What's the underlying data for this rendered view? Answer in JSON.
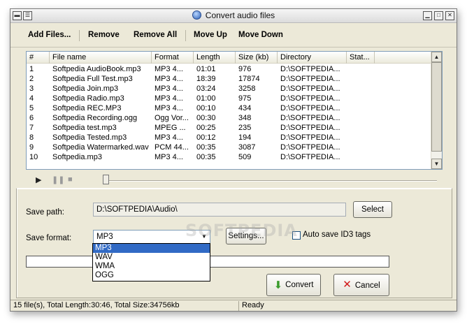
{
  "window": {
    "title": "Convert audio files"
  },
  "toolbar": {
    "add_files": "Add Files...",
    "remove": "Remove",
    "remove_all": "Remove All",
    "move_up": "Move Up",
    "move_down": "Move Down"
  },
  "list": {
    "columns": [
      "#",
      "File name",
      "Format",
      "Length",
      "Size (kb)",
      "Directory",
      "Stat..."
    ],
    "rows": [
      [
        "1",
        "Softpedia AudioBook.mp3",
        "MP3  4...",
        "01:01",
        "976",
        "D:\\SOFTPEDIA..."
      ],
      [
        "2",
        "Softpedia Full Test.mp3",
        "MP3  4...",
        "18:39",
        "17874",
        "D:\\SOFTPEDIA..."
      ],
      [
        "3",
        "Softpedia Join.mp3",
        "MP3  4...",
        "03:24",
        "3258",
        "D:\\SOFTPEDIA..."
      ],
      [
        "4",
        "Softpedia Radio.mp3",
        "MP3  4...",
        "01:00",
        "975",
        "D:\\SOFTPEDIA..."
      ],
      [
        "5",
        "Softpedia REC.MP3",
        "MP3  4...",
        "00:10",
        "434",
        "D:\\SOFTPEDIA..."
      ],
      [
        "6",
        "Softpedia Recording.ogg",
        "Ogg Vor...",
        "00:30",
        "348",
        "D:\\SOFTPEDIA..."
      ],
      [
        "7",
        "Softpedia test.mp3",
        "MPEG ...",
        "00:25",
        "235",
        "D:\\SOFTPEDIA..."
      ],
      [
        "8",
        "Softpedia Tested.mp3",
        "MP3  4...",
        "00:12",
        "194",
        "D:\\SOFTPEDIA..."
      ],
      [
        "9",
        "Softpedia Watermarked.wav",
        "PCM 44...",
        "00:35",
        "3087",
        "D:\\SOFTPEDIA..."
      ],
      [
        "10",
        "Softpedia.mp3",
        "MP3  4...",
        "00:35",
        "509",
        "D:\\SOFTPEDIA..."
      ]
    ]
  },
  "player": {
    "play_icon": "play-icon",
    "pause_icon": "pause-icon",
    "stop_icon": "stop-icon"
  },
  "settings": {
    "save_path_label": "Save path:",
    "save_path_value": "D:\\SOFTPEDIA\\Audio\\",
    "select_label": "Select",
    "save_format_label": "Save format:",
    "save_format_value": "MP3",
    "settings_label": "Settings...",
    "auto_id3_label": "Auto save ID3 tags",
    "format_options": [
      "MP3",
      "WAV",
      "WMA",
      "OGG"
    ],
    "convert_label": "Convert",
    "cancel_label": "Cancel"
  },
  "status": {
    "summary": "15 file(s), Total Length:30:46, Total Size:34756kb",
    "state": "Ready"
  },
  "watermark": "SOFTPEDIA",
  "colors": {
    "window_bg": "#ece9d8",
    "selection": "#316ac5",
    "cancel_red": "#d11a1a",
    "convert_green": "#3a9b2d"
  }
}
